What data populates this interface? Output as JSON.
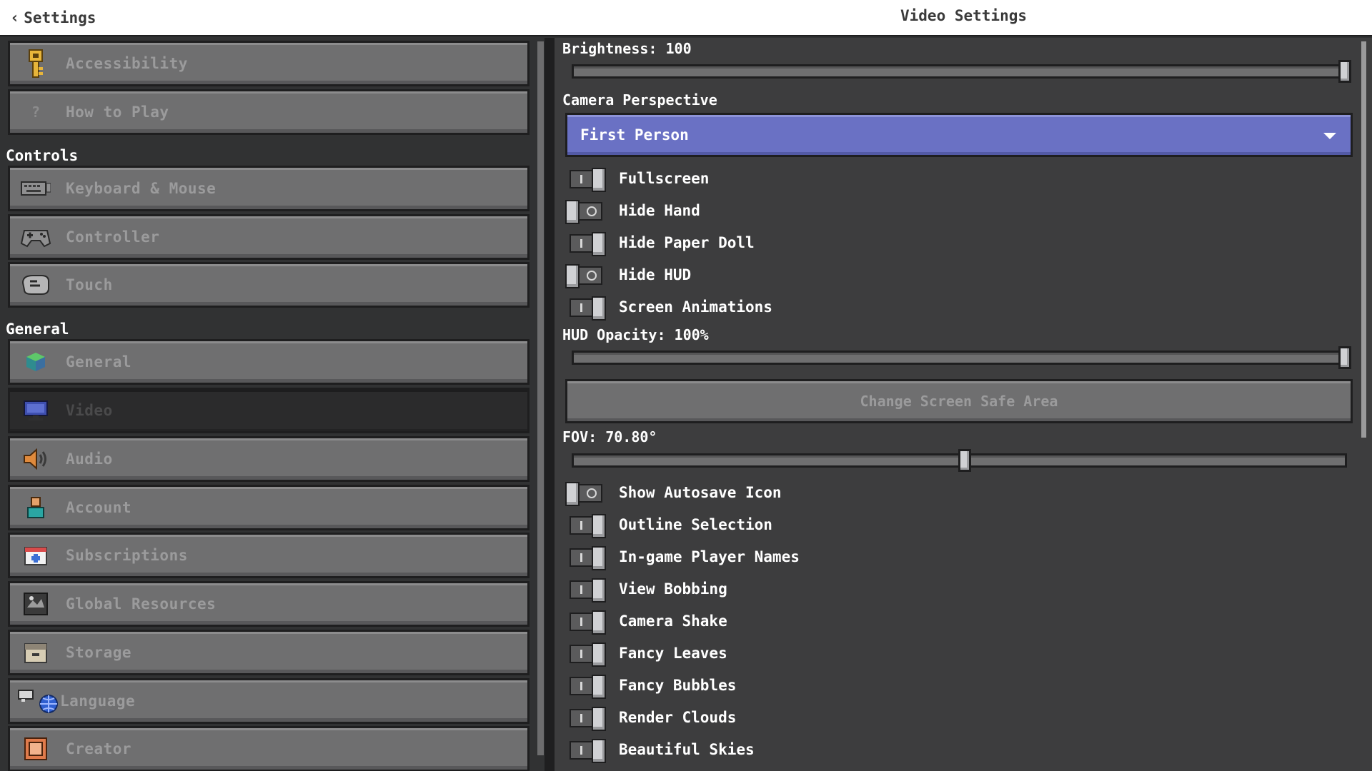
{
  "header": {
    "back_label": "Settings",
    "title": "Video Settings"
  },
  "sidebar": {
    "items_top": [
      {
        "label": "Accessibility",
        "icon": "key-icon"
      },
      {
        "label": "How to Play",
        "icon": "question-icon"
      }
    ],
    "controls_heading": "Controls",
    "controls": [
      {
        "label": "Keyboard & Mouse",
        "icon": "keyboard-icon"
      },
      {
        "label": "Controller",
        "icon": "gamepad-icon"
      },
      {
        "label": "Touch",
        "icon": "touch-icon"
      }
    ],
    "general_heading": "General",
    "general": [
      {
        "label": "General",
        "icon": "cube-icon"
      },
      {
        "label": "Video",
        "icon": "monitor-icon",
        "selected": true
      },
      {
        "label": "Audio",
        "icon": "speaker-icon"
      },
      {
        "label": "Account",
        "icon": "account-icon"
      },
      {
        "label": "Subscriptions",
        "icon": "subscriptions-icon"
      },
      {
        "label": "Global Resources",
        "icon": "global-resources-icon"
      },
      {
        "label": "Storage",
        "icon": "storage-icon"
      },
      {
        "label": "Language",
        "icon": "language-icon"
      },
      {
        "label": "Creator",
        "icon": "creator-icon"
      }
    ]
  },
  "video": {
    "brightness_label": "Brightness: 100",
    "brightness_value": 1.0,
    "camera_perspective_label": "Camera Perspective",
    "camera_perspective_value": "First Person",
    "toggles_a": [
      {
        "label": "Fullscreen",
        "on": true
      },
      {
        "label": "Hide Hand",
        "on": false
      },
      {
        "label": "Hide Paper Doll",
        "on": true
      },
      {
        "label": "Hide HUD",
        "on": false
      },
      {
        "label": "Screen Animations",
        "on": true
      }
    ],
    "hud_opacity_label": "HUD Opacity: 100%",
    "hud_opacity_value": 1.0,
    "safe_area_button": "Change Screen Safe Area",
    "fov_label": "FOV: 70.80°",
    "fov_value": 0.507,
    "toggles_b": [
      {
        "label": "Show Autosave Icon",
        "on": false
      },
      {
        "label": "Outline Selection",
        "on": true
      },
      {
        "label": "In-game Player Names",
        "on": true
      },
      {
        "label": "View Bobbing",
        "on": true
      },
      {
        "label": "Camera Shake",
        "on": true
      },
      {
        "label": "Fancy Leaves",
        "on": true
      },
      {
        "label": "Fancy Bubbles",
        "on": true
      },
      {
        "label": "Render Clouds",
        "on": true
      },
      {
        "label": "Beautiful Skies",
        "on": true
      }
    ]
  }
}
